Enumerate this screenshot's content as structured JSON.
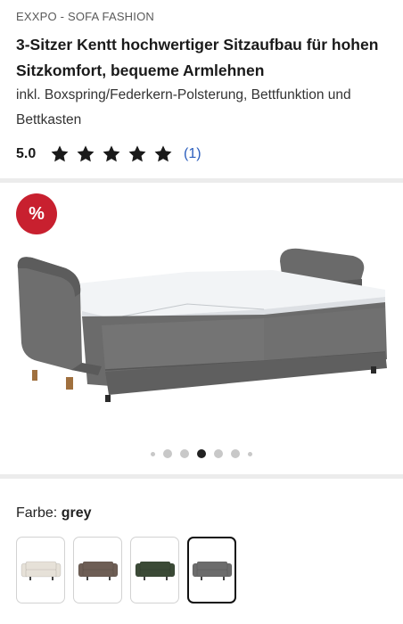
{
  "product": {
    "brand": "EXXPO - SOFA FASHION",
    "title": "3-Sitzer Kentt hochwertiger Sitzaufbau für hohen Sitzkomfort, bequeme Armlehnen",
    "subtitle": "inkl. Boxspring/Federkern-Polsterung, Bettfunktion und Bettkasten"
  },
  "rating": {
    "value": "5.0",
    "stars_filled": 5,
    "stars_total": 5,
    "review_count": "(1)",
    "star_color": "#1a1a1a",
    "link_color": "#2a5dbd"
  },
  "gallery": {
    "badge": "%",
    "badge_color": "#c8202f",
    "image_icon": "sofa-bed-image",
    "dots_count": 7,
    "active_dot": 3
  },
  "color_selector": {
    "label": "Farbe:",
    "selected_value": "grey",
    "swatches": [
      {
        "name": "cream",
        "color": "#e6e1d8",
        "selected": false
      },
      {
        "name": "brown",
        "color": "#6e5e55",
        "selected": false
      },
      {
        "name": "green",
        "color": "#3b4a36",
        "selected": false
      },
      {
        "name": "grey",
        "color": "#6c6c6c",
        "selected": true
      }
    ]
  }
}
